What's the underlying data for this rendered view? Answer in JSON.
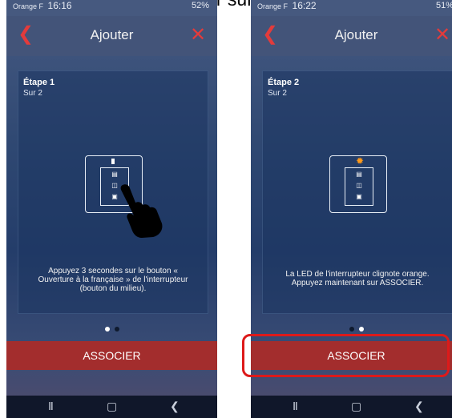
{
  "caption": "dessous, et cliquer sur « ASSOCIER »",
  "screens": [
    {
      "status": {
        "operator": "Orange F",
        "time": "16:16",
        "right": "52%"
      },
      "title": "Ajouter",
      "step": "Étape 1",
      "step_of": "Sur 2",
      "desc1": "Appuyez 3 secondes sur le bouton «",
      "desc2": "Ouverture à la française » de l'interrupteur",
      "desc3": "(bouton du milieu).",
      "button": "ASSOCIER",
      "active_dot": 1
    },
    {
      "status": {
        "operator": "Orange F",
        "time": "16:22",
        "right": "51%"
      },
      "title": "Ajouter",
      "step": "Étape 2",
      "step_of": "Sur 2",
      "desc1": "La LED de l'interrupteur clignote orange.",
      "desc2": "Appuyez maintenant sur ASSOCIER.",
      "button": "ASSOCIER",
      "active_dot": 2
    }
  ],
  "icons": [
    "back-arrow-icon",
    "close-icon",
    "switch-icon",
    "hand-pointer-icon",
    "led-star-icon",
    "recents-icon",
    "home-icon",
    "back-nav-icon"
  ],
  "colors": {
    "accent_red": "#a32d2d",
    "icon_red": "#e33b3b",
    "highlight": "#dd1a1a",
    "led_orange": "#ff9a1a"
  }
}
